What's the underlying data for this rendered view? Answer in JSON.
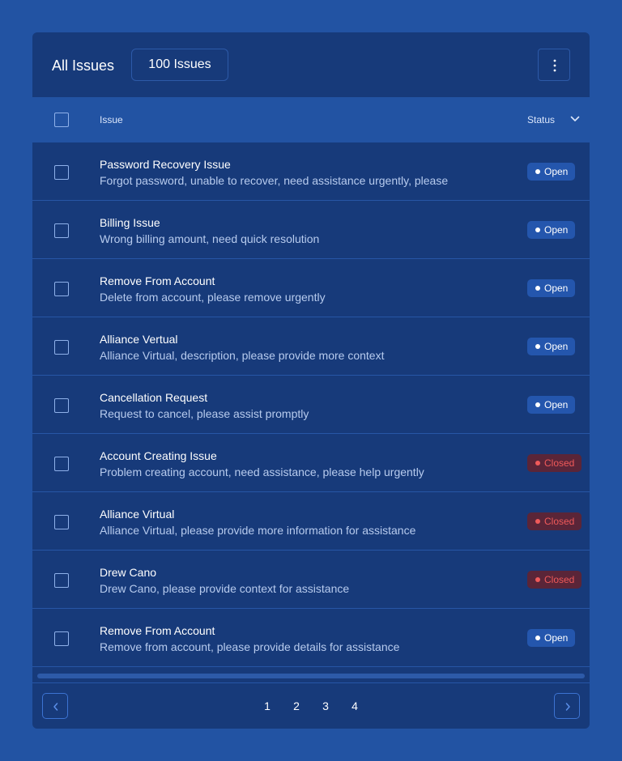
{
  "header": {
    "title": "All Issues",
    "count_label": "100 Issues",
    "more_icon": "vertical-ellipsis-icon"
  },
  "table": {
    "columns": {
      "issue": "Issue",
      "status": "Status"
    },
    "rows": [
      {
        "title": "Password Recovery Issue",
        "description": "Forgot password, unable to recover, need assistance urgently, please",
        "status": "Open"
      },
      {
        "title": "Billing Issue",
        "description": "Wrong billing amount, need quick resolution",
        "status": "Open"
      },
      {
        "title": "Remove From Account",
        "description": "Delete from account, please remove urgently",
        "status": "Open"
      },
      {
        "title": "Alliance Vertual",
        "description": "Alliance Virtual, description, please provide more context",
        "status": "Open"
      },
      {
        "title": "Cancellation Request",
        "description": "Request to cancel, please assist promptly",
        "status": "Open"
      },
      {
        "title": "Account Creating Issue",
        "description": "Problem creating account, need assistance, please help urgently",
        "status": "Closed"
      },
      {
        "title": "Alliance Virtual",
        "description": "Alliance Virtual, please provide more information for assistance",
        "status": "Closed"
      },
      {
        "title": "Drew Cano",
        "description": "Drew Cano, please provide context for assistance",
        "status": "Closed"
      },
      {
        "title": "Remove From Account",
        "description": "Remove from account, please provide details for assistance",
        "status": "Open"
      }
    ]
  },
  "pagination": {
    "pages": [
      "1",
      "2",
      "3",
      "4"
    ],
    "prev_icon": "chevron-left-icon",
    "next_icon": "chevron-right-icon"
  },
  "colors": {
    "background": "#2253a3",
    "card": "#173a7a",
    "open_badge": "#2456ad",
    "closed_badge": "#5a2538",
    "closed_text": "#f05a5a"
  }
}
